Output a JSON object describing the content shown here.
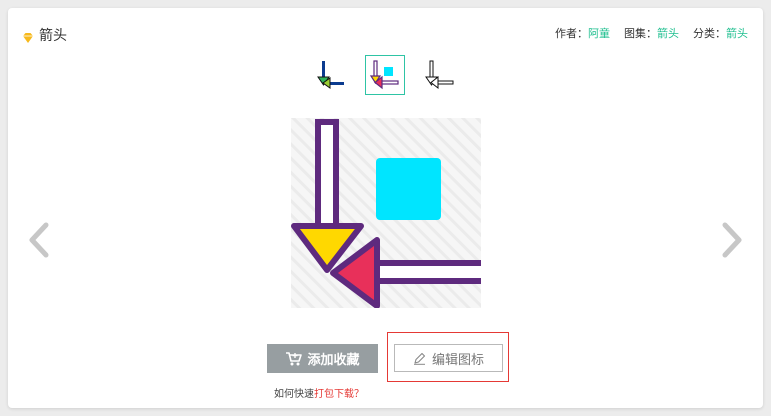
{
  "header": {
    "title": "箭头",
    "author_label": "作者：",
    "author": "阿童",
    "album_label": "图集：",
    "album": "箭头",
    "category_label": "分类：",
    "category": "箭头"
  },
  "thumbnails": [
    {
      "name": "arrow-style-1"
    },
    {
      "name": "arrow-style-2",
      "selected": true
    },
    {
      "name": "arrow-style-3"
    }
  ],
  "actions": {
    "favorite_label": "添加收藏",
    "edit_label": "编辑图标"
  },
  "help": {
    "prefix": "如何快速",
    "link": "打包下载",
    "suffix": "？"
  },
  "colors": {
    "accent": "#1fbf8f",
    "purple": "#5e2a7e",
    "yellow": "#ffd800",
    "pink": "#e8305a",
    "cyan": "#00e5ff",
    "highlight_border": "#e53935"
  }
}
